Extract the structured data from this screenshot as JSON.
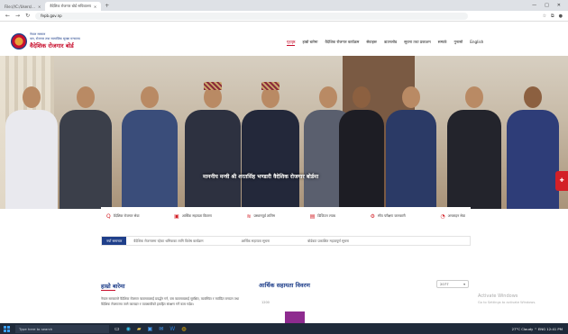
{
  "browser": {
    "tabs": [
      {
        "label": "File:///C:/Users/..."
      },
      {
        "label": "वैदेशिक रोजगार बोर्ड सचिवालय"
      }
    ],
    "address": "fepb.gov.np",
    "window_controls": [
      "—",
      "□",
      "✕"
    ]
  },
  "site": {
    "logo_top": "नेपाल सरकार",
    "logo_sub": "श्रम, रोजगार तथा सामाजिक सुरक्षा मन्त्रालय",
    "logo_title": "वैदेशिक रोजगार बोर्ड",
    "nav": [
      "गृहपृष्ठ",
      "हाम्रो बारेमा",
      "वैदेशिक रोजगार कार्यक्रम",
      "सेवाहरू",
      "डाउनलोड",
      "सूचना तथा प्रकाशन",
      "सम्पर्क",
      "गुनासो",
      "English"
    ]
  },
  "hero": {
    "caption": "माननीय मन्त्री श्री शरतसिंह भण्डारी वैदेशिक रोजगार बोर्डमा",
    "side_button": "✚"
  },
  "quick_links": [
    {
      "icon": "Q",
      "label": "वैदेशिक रोजगार सेवा"
    },
    {
      "icon": "▣",
      "label": "आर्थिक सहायता विवरण"
    },
    {
      "icon": "≋",
      "label": "प्रस्थानपूर्व तालिम"
    },
    {
      "icon": "▤",
      "label": "डिजिटल ल्याब"
    },
    {
      "icon": "⚙",
      "label": "सीप परीक्षण जानकारी"
    },
    {
      "icon": "◔",
      "label": "अनलाइन सेवा"
    }
  ],
  "ticker": {
    "badge": "नयाँ समाचार",
    "items": [
      "वैदेशिक रोजगारमा रहेका श्रमिकका लागि विशेष कार्यक्रम",
      "आर्थिक सहायता सूचना",
      "बोर्डबाट प्रकाशित महत्वपूर्ण सूचना"
    ]
  },
  "about": {
    "title": "हाम्रो बारेमा",
    "text": "नेपाल सरकारले वैदेशिक रोजगार व्यवसायलाई प्रवर्द्धन गर्न, यस व्यवसायलाई सुरक्षित, व्यवस्थित र मर्यादित बनाउन तथा वैदेशिक रोजगारमा जाने कामदार र व्यवसायीको हकहित संरक्षण गर्ने काम गर्दछ।"
  },
  "finance": {
    "title": "आर्थिक सहायता विवरण",
    "year": "2077",
    "axis_label": "1200"
  },
  "watermark": {
    "title": "Activate Windows",
    "sub": "Go to Settings to activate Windows."
  },
  "taskbar": {
    "search": "Type here to search",
    "tray": "27°C Cloudy  ^  ENG  12:41 PM"
  },
  "colors": {
    "brand_red": "#c8102e",
    "brand_blue": "#1f3f8a",
    "chart_bar": "#8e2b8f"
  }
}
